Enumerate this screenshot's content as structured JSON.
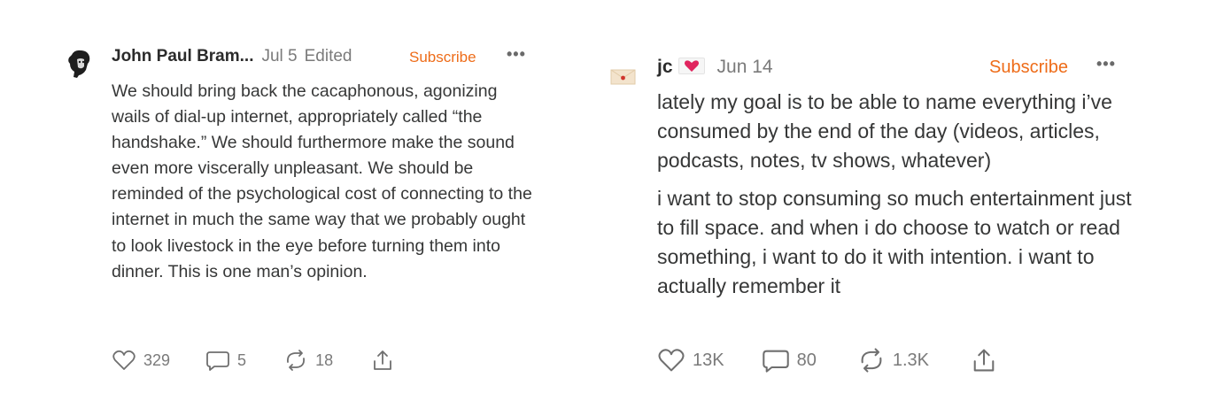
{
  "notes": [
    {
      "author": "John Paul Bram...",
      "date": "Jul 5",
      "edited": "Edited",
      "subscribe": "Subscribe",
      "more_icon": "more-horizontal-icon",
      "paragraphs": [
        "We should bring back the cacaphonous, agonizing wails of dial-up internet, appropriately called “the handshake.” We should furthermore make the sound even more viscerally unpleasant. We should be reminded of the psychological cost of connecting to the internet in much the same way that we probably ought to look livestock in the eye before turning them into dinner. This is one man’s opinion."
      ],
      "likes": "329",
      "comments": "5",
      "restacks": "18"
    },
    {
      "author": "jc",
      "date": "Jun 14",
      "subscribe": "Subscribe",
      "more_icon": "more-horizontal-icon",
      "paragraphs": [
        "lately my goal is to be able to name everything i’ve consumed by the end of the day (videos, articles, podcasts, notes, tv shows, whatever)",
        "i want to stop consuming so much entertainment just to fill space. and when i do choose to watch or read something, i want to do it with intention. i want to actually remember it"
      ],
      "likes": "13K",
      "comments": "80",
      "restacks": "1.3K"
    }
  ],
  "colors": {
    "accent": "#ee6c19",
    "text": "#363737",
    "muted": "#7a7a7a"
  }
}
